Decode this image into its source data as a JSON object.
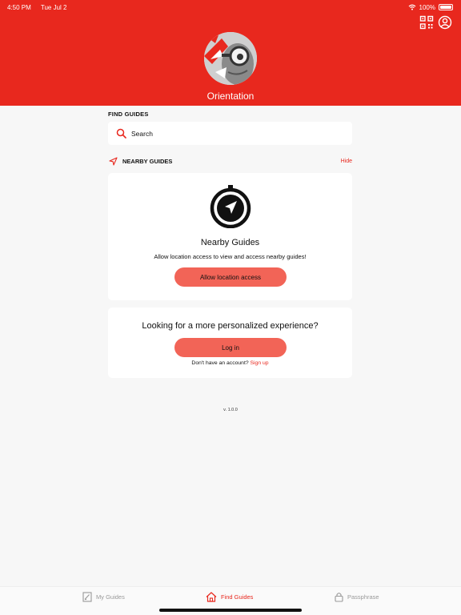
{
  "status_bar": {
    "time": "4:50 PM",
    "date": "Tue Jul 2",
    "battery": "100%"
  },
  "header": {
    "title": "Orientation",
    "qr_icon": "qr-code-icon",
    "profile_icon": "user-circle-icon",
    "bg_color": "#e8281e"
  },
  "find_guides": {
    "label": "FIND GUIDES",
    "search_placeholder": "Search"
  },
  "nearby": {
    "label": "NEARBY GUIDES",
    "hide_label": "Hide",
    "card_title": "Nearby Guides",
    "card_subtitle": "Allow location access to view and access nearby guides!",
    "button_label": "Allow location access"
  },
  "login": {
    "title": "Looking for a more personalized experience?",
    "button_label": "Log in",
    "signup_prompt": "Don't have an account?",
    "signup_link": "Sign up"
  },
  "version": "v. 1.0.0",
  "tabs": [
    {
      "label": "My Guides",
      "icon": "guides-icon",
      "active": false
    },
    {
      "label": "Find Guides",
      "icon": "home-icon",
      "active": true
    },
    {
      "label": "Passphrase",
      "icon": "lock-icon",
      "active": false
    }
  ],
  "colors": {
    "accent": "#e8281e",
    "button": "#f26457",
    "background": "#f7f7f7"
  }
}
